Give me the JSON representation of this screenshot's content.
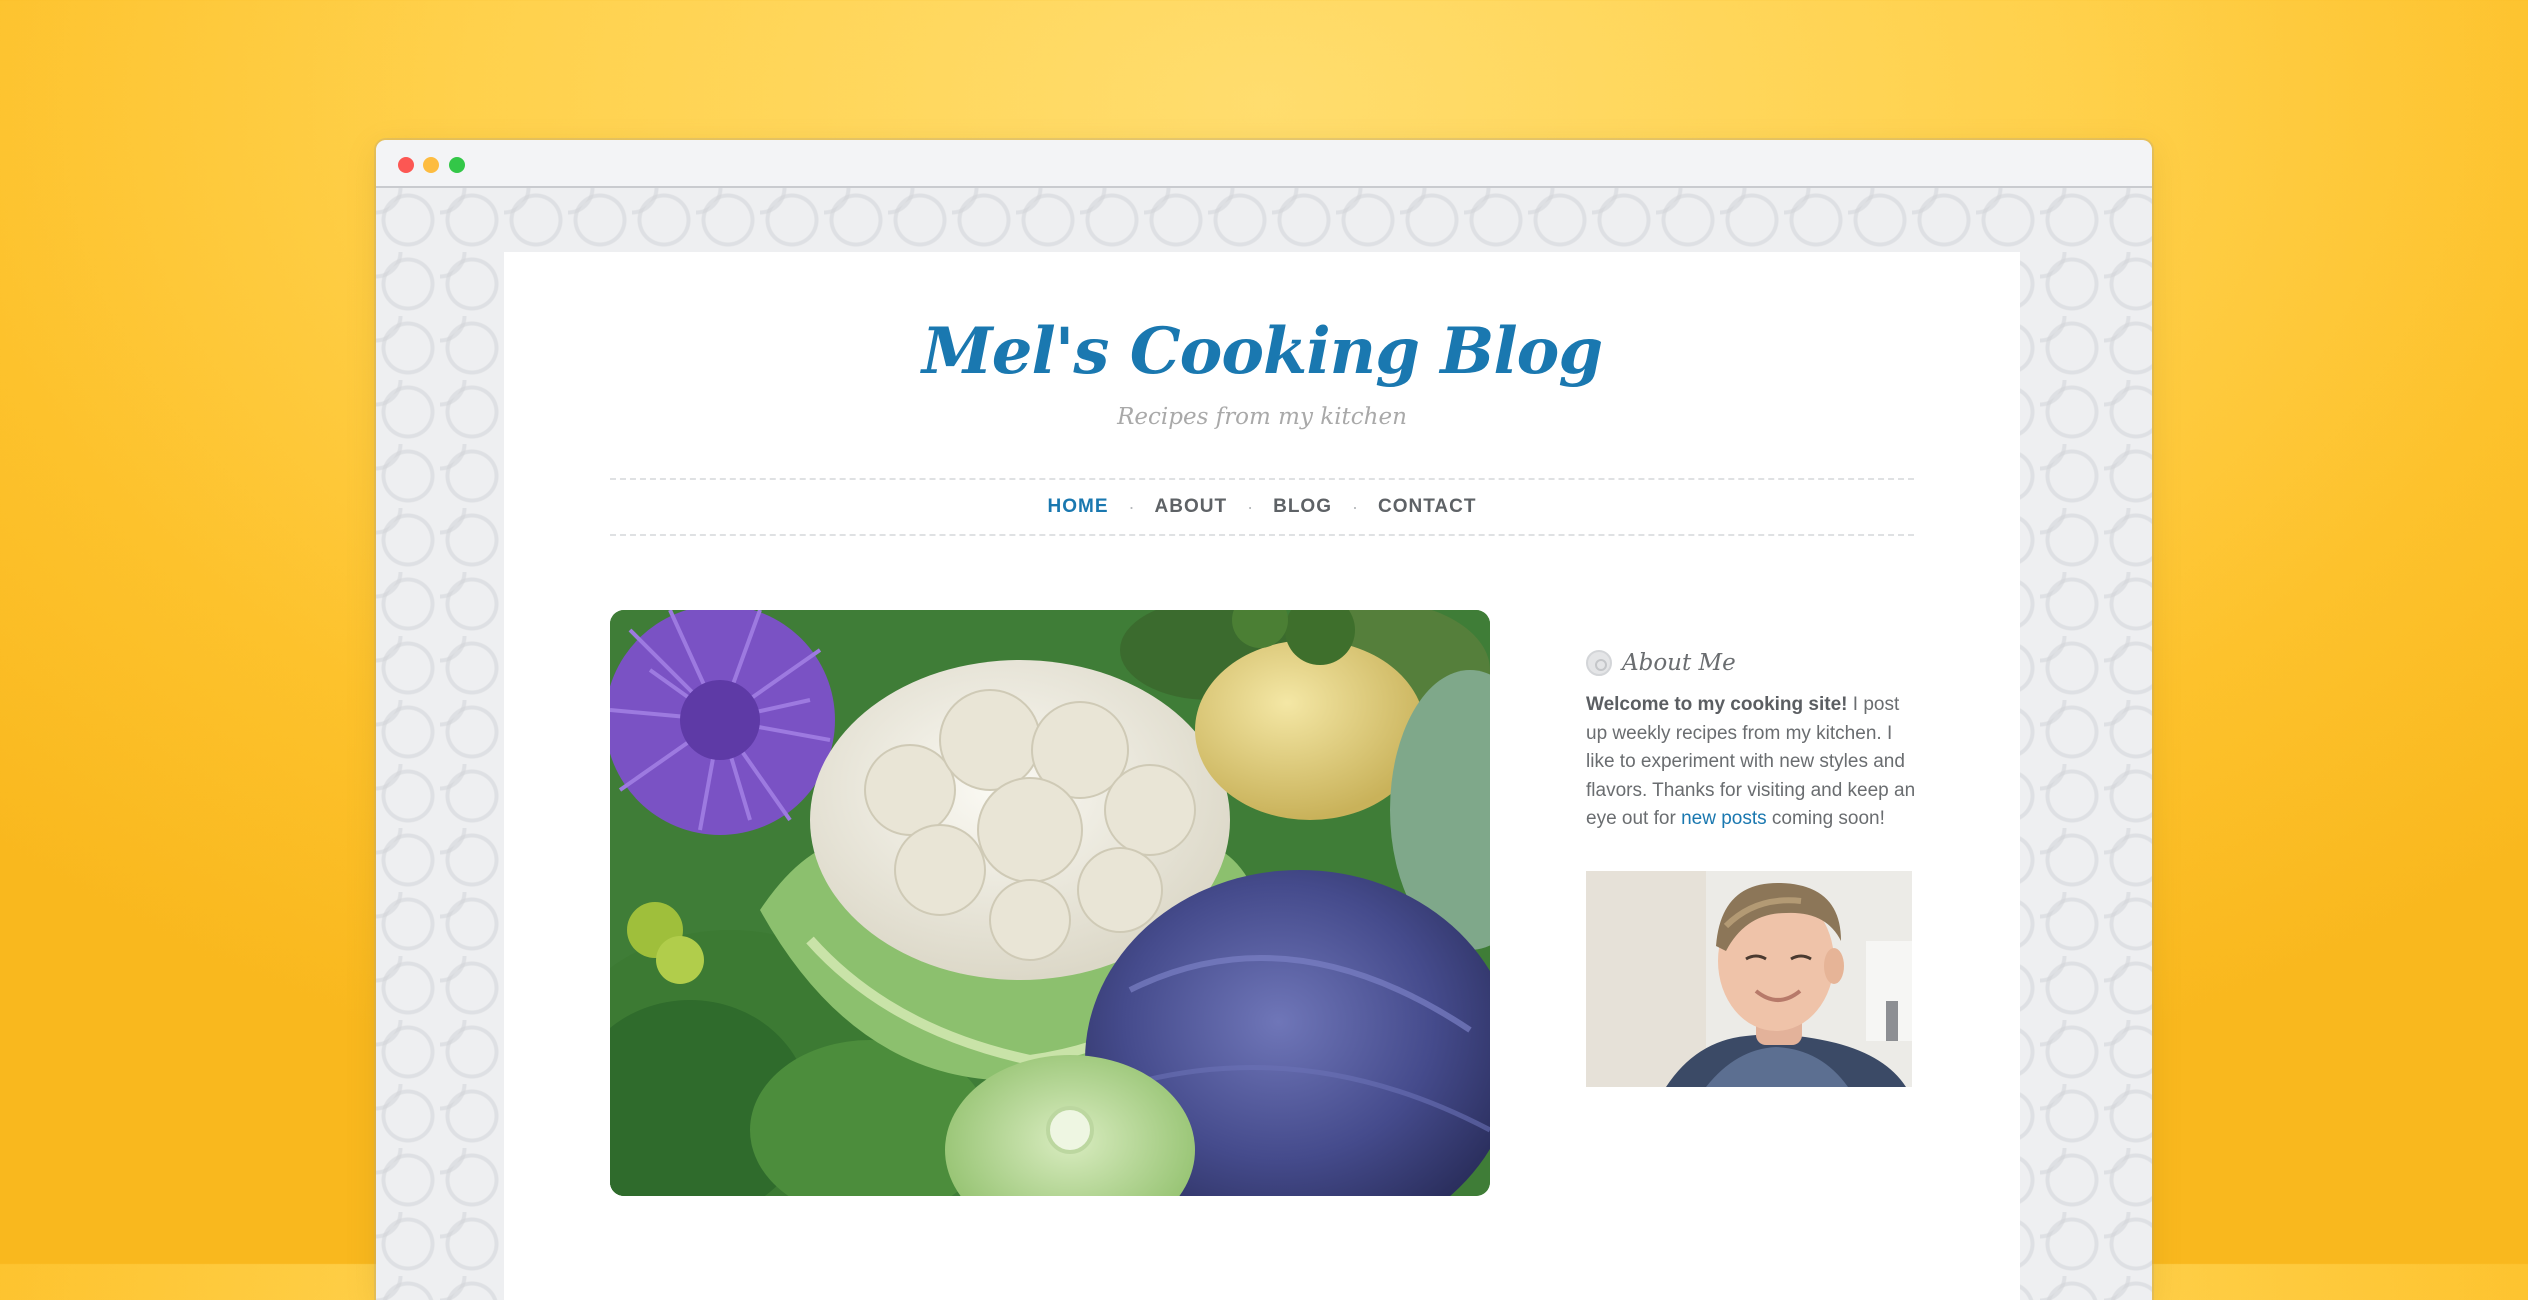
{
  "window": {
    "controls": [
      "close",
      "minimize",
      "zoom"
    ]
  },
  "site": {
    "title": "Mel's Cooking Blog",
    "tagline": "Recipes from my kitchen"
  },
  "nav": {
    "items": [
      {
        "label": "HOME",
        "active": true
      },
      {
        "label": "ABOUT",
        "active": false
      },
      {
        "label": "BLOG",
        "active": false
      },
      {
        "label": "CONTACT",
        "active": false
      }
    ],
    "separator": "·"
  },
  "featured_image": {
    "icon": "vegetables-photo"
  },
  "sidebar": {
    "about_title": "About Me",
    "about_bold": "Welcome to my cooking site!",
    "about_text_1": " I post up weekly recipes from my kitchen. I like to experiment with new styles and flavors. Thanks for visiting and keep an eye out for ",
    "about_link": "new posts",
    "about_text_2": " coming soon!",
    "portrait_icon": "portrait-photo"
  },
  "colors": {
    "accent": "#1a78b0",
    "background": "#fdc22c",
    "text": "#6a6d70"
  }
}
